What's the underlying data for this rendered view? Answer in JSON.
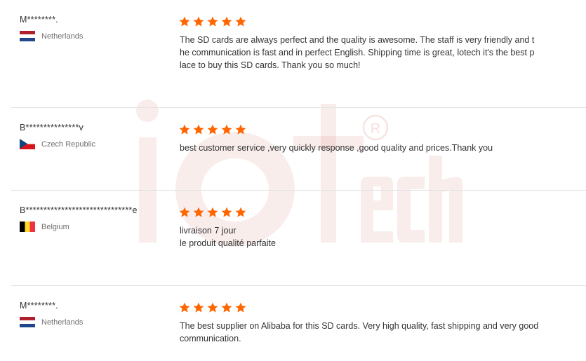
{
  "watermark": {
    "brand": "iotech",
    "registered_mark": "R"
  },
  "colors": {
    "star": "#ff6600",
    "watermark": "#c0392b",
    "divider": "#e2e2e2"
  },
  "reviews": [
    {
      "buyer": "M********.",
      "country": "Netherlands",
      "flag": "nl",
      "rating": 5,
      "lines": [
        "The SD cards are always perfect and the quality is awesome. The staff is very friendly and t",
        "he communication is fast and in perfect English. Shipping time is great, lotech it's the best p",
        "lace to buy this SD cards. Thank you so much!"
      ]
    },
    {
      "buyer": "B***************v",
      "country": "Czech Republic",
      "flag": "cz",
      "rating": 5,
      "lines": [
        "best customer service ,very quickly response ,good quality and prices.Thank you"
      ]
    },
    {
      "buyer": "B******************************e",
      "country": "Belgium",
      "flag": "be",
      "rating": 5,
      "lines": [
        "livraison 7 jour",
        "le produit qualité parfaite"
      ]
    },
    {
      "buyer": "M********.",
      "country": "Netherlands",
      "flag": "nl",
      "rating": 5,
      "lines": [
        "The best supplier on Alibaba for this SD cards. Very high quality, fast shipping and very good",
        "communication."
      ]
    }
  ]
}
